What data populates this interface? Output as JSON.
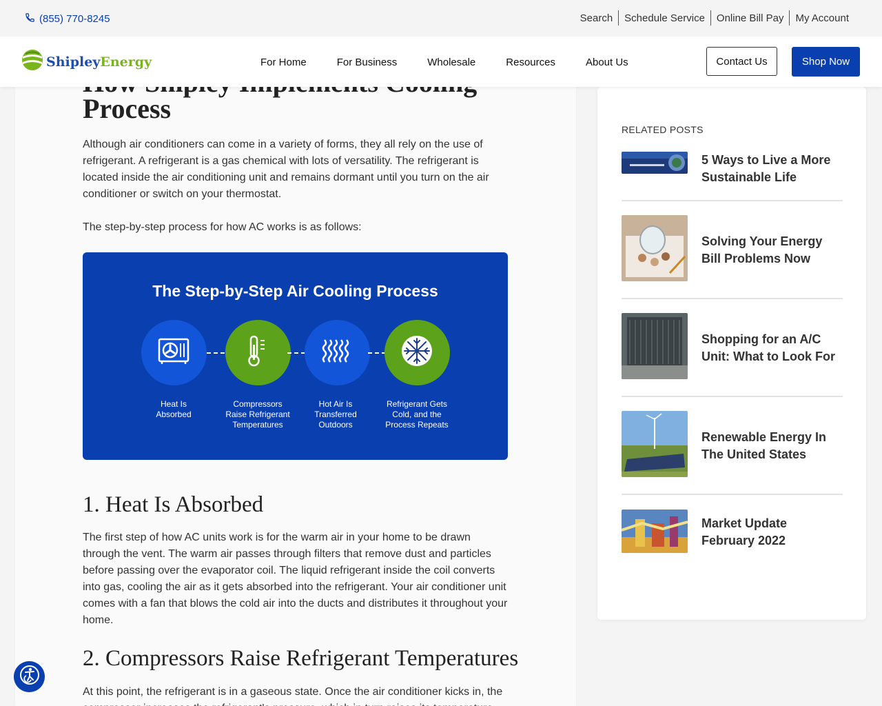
{
  "topbar": {
    "phone": "(855) 770-8245",
    "links": [
      "Search",
      "Schedule Service",
      "Online Bill Pay",
      "My Account"
    ]
  },
  "header": {
    "logo_part1": "Shipley",
    "logo_part2": "Energy",
    "nav": [
      "For Home",
      "For Business",
      "Wholesale",
      "Resources",
      "About Us"
    ],
    "contact_label": "Contact Us",
    "shop_label": "Shop Now"
  },
  "article": {
    "title_line1_partial": "How Shipley Implements Cooling",
    "title_line2": "Process",
    "intro": "Although air conditioners can come in a variety of forms, they all rely on the use of refrigerant. A refrigerant is a gas chemical with lots of versatility. The refrigerant is located inside the air conditioning unit and remains dormant until you turn on the air conditioner or switch on your thermostat.",
    "steps_intro": "The step-by-step process for how AC works is as follows:",
    "infographic": {
      "title": "The Step-by-Step Air Cooling Process",
      "steps": [
        {
          "label": "Heat Is Absorbed",
          "icon": "ac-unit-icon",
          "color": "#1255d8"
        },
        {
          "label": "Compressors Raise Refrigerant Temperatures",
          "icon": "thermometer-icon",
          "color": "#5ca21a"
        },
        {
          "label": "Hot Air Is Transferred Outdoors",
          "icon": "heat-waves-icon",
          "color": "#1255d8"
        },
        {
          "label": "Refrigerant Gets Cold, and the Process Repeats",
          "icon": "snowflake-icon",
          "color": "#5ca21a"
        }
      ]
    },
    "h_step1": "1. Heat Is Absorbed",
    "p_step1": "The first step of how AC units work is for the warm air in your home to be drawn through the vent. The warm air passes through filters that remove dust and particles before passing over the evaporator coil. The liquid refrigerant inside the coil converts into gas, cooling the air as it gets absorbed into the refrigerant. Your air conditioner unit comes with a fan that blows the cold air into the ducts and distributes it throughout your home.",
    "h_step2": "2. Compressors Raise Refrigerant Temperatures",
    "p_step2": "At this point, the refrigerant is in a gaseous state. Once the air conditioner kicks in, the compressor increases the refrigerant's pressure, which in turn raises its temperature and"
  },
  "sidebar": {
    "related_title": "RELATED POSTS",
    "posts": [
      {
        "title": "5 Ways to Live a More Sustainable Life"
      },
      {
        "title": "Solving Your Energy Bill Problems Now"
      },
      {
        "title": "Shopping for an A/C Unit: What to Look For"
      },
      {
        "title": "Renewable Energy In The United States"
      },
      {
        "title": "Market Update February 2022"
      }
    ]
  },
  "colors": {
    "brand_blue": "#0a3fb0",
    "brand_green": "#7ab51d"
  }
}
